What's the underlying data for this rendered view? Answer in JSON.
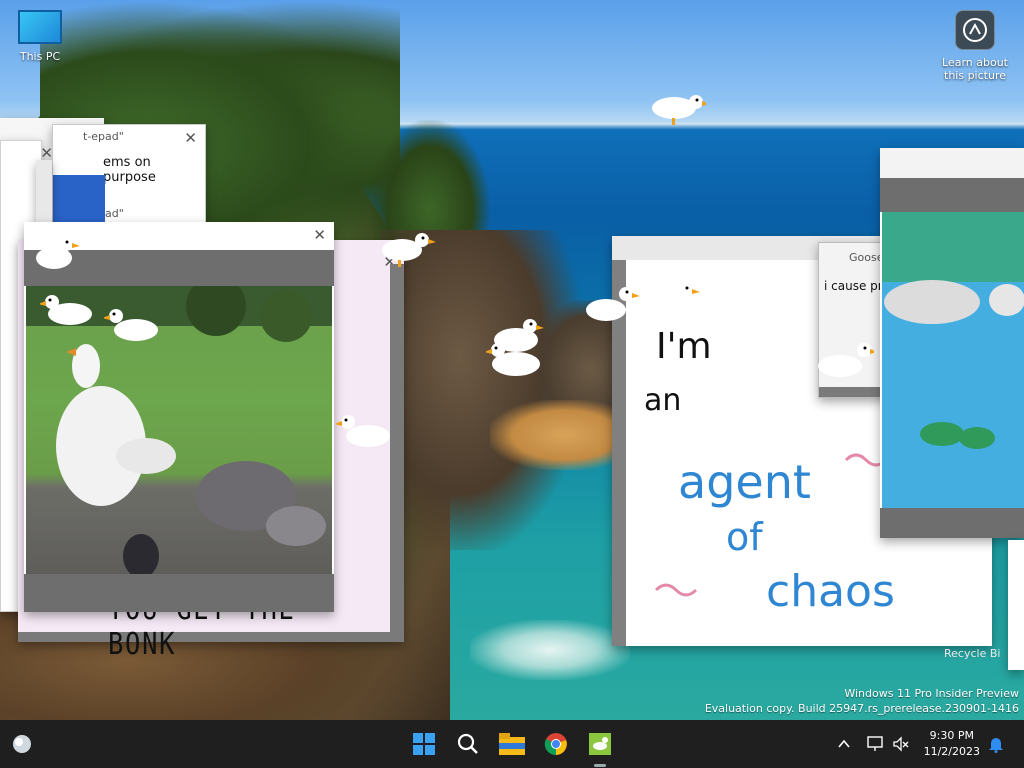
{
  "desktop": {
    "this_pc_label": "This PC",
    "learn_label_1": "Learn about",
    "learn_label_2": "this picture",
    "recycle_label": "Recycle Bi"
  },
  "windows": {
    "notepad_title_1": "t-epad\"",
    "notepad_body": "ems on purpose",
    "notepad_title_2": "t-epad\"",
    "bonk_text": "YOU GET THE BONK",
    "drawing_lines": [
      "I'm",
      "an",
      "agent",
      "of",
      "chaos"
    ],
    "goose_title": "Goose",
    "goose_body": "i cause pr",
    "close_glyph": "✕"
  },
  "watermark": {
    "line1": "Windows 11 Pro Insider Preview",
    "line2": "Evaluation copy. Build 25947.rs_prerelease.230901-1416"
  },
  "taskbar": {
    "time": "9:30 PM",
    "date": "11/2/2023",
    "icons": [
      "weather-icon",
      "start-icon",
      "search-icon",
      "file-explorer-icon",
      "chrome-icon",
      "desktop-goose-icon"
    ],
    "tray_icons": [
      "chevron-up-icon",
      "network-icon",
      "volume-muted-icon",
      "notification-bell-icon"
    ]
  },
  "colors": {
    "taskbar_bg": "#1f1f1f",
    "drawing_blue": "#2f86d3",
    "drawing_pink": "#e58aa6",
    "start_blue": "#3aa0f0"
  }
}
